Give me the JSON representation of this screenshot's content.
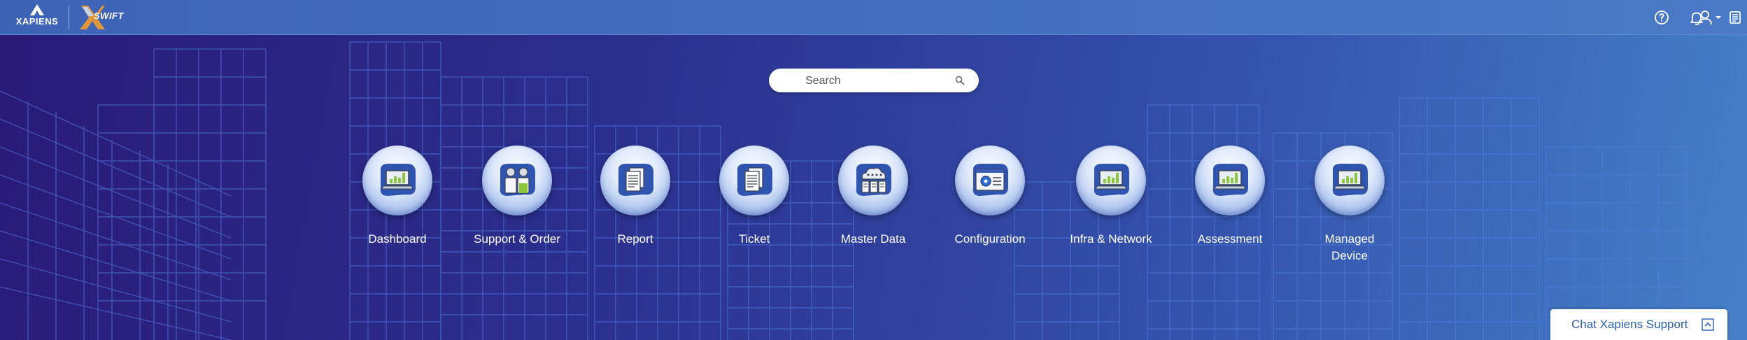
{
  "header": {
    "brand_name": "XAPIENS",
    "product_name": "SWIFT",
    "icons": [
      {
        "name": "help-icon"
      },
      {
        "name": "bell-icon"
      },
      {
        "name": "document-icon"
      },
      {
        "name": "user-icon"
      }
    ]
  },
  "search": {
    "placeholder": "Search"
  },
  "modules": [
    {
      "label": "Dashboard",
      "icon": "laptop-chart-icon"
    },
    {
      "label": "Support & Order",
      "icon": "support-order-icon"
    },
    {
      "label": "Report",
      "icon": "report-document-icon"
    },
    {
      "label": "Ticket",
      "icon": "ticket-document-icon"
    },
    {
      "label": "Master Data",
      "icon": "cloud-server-icon"
    },
    {
      "label": "Configuration",
      "icon": "configuration-gear-icon"
    },
    {
      "label": "Infra & Network",
      "icon": "laptop-chart-icon"
    },
    {
      "label": "Assessment",
      "icon": "laptop-chart-icon"
    },
    {
      "label": "Managed Device",
      "icon": "laptop-chart-icon"
    }
  ],
  "chat": {
    "label": "Chat Xapiens Support"
  },
  "colors": {
    "topbar": "#4a79c6",
    "background_dark": "#2a1a78",
    "accent": "#2a5fb0",
    "icon_green": "#8cc63f"
  }
}
